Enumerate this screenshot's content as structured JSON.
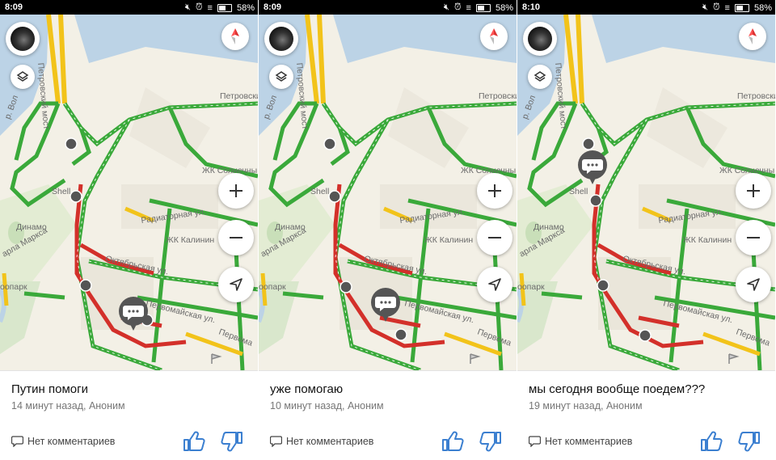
{
  "screens": [
    {
      "status_time": "8:09",
      "battery": "58%",
      "map_labels": {
        "bridge": "Петровский мост",
        "river": "р. Вол",
        "petrovsky": "Петровски",
        "solnechny": "ЖК Солнечны",
        "radiator": "Радиаторная ул.",
        "kalinin": "ЖК Калинин",
        "dinamo": "Динамо",
        "marx": "арла Маркса",
        "oktyabr": "Октябрьская ул.",
        "pervomay": "Первомайская ул.",
        "pervoma2": "Первома",
        "zoopark": "оопарк",
        "shell": "Shell"
      },
      "post": {
        "title": "Путин помоги",
        "meta": "14 минут назад, Аноним",
        "comments": "Нет комментариев"
      }
    },
    {
      "status_time": "8:09",
      "battery": "58%",
      "map_labels": {
        "bridge": "Петровский мост",
        "river": "р. Вол",
        "petrovsky": "Петровски",
        "solnechny": "ЖК Солнечны",
        "radiator": "Радиаторная ул.",
        "kalinin": "ЖК Калинин",
        "dinamo": "Динамо",
        "marx": "арла Маркса",
        "oktyabr": "Октябрьская ул.",
        "pervomay": "Первомайская ул.",
        "pervoma2": "Первома",
        "zoopark": "оопарк",
        "shell": "Shell"
      },
      "post": {
        "title": "уже помогаю",
        "meta": "10 минут назад, Аноним",
        "comments": "Нет комментариев"
      }
    },
    {
      "status_time": "8:10",
      "battery": "58%",
      "map_labels": {
        "bridge": "Петровский мост",
        "river": "р. Вол",
        "petrovsky": "Петровски",
        "solnechny": "ЖК Солнечны",
        "radiator": "Радиаторная ул.",
        "kalinin": "ЖК Калинин",
        "dinamo": "Динамо",
        "marx": "арла Маркса",
        "oktyabr": "Октябрьская ул.",
        "pervomay": "Первомайская ул.",
        "pervoma2": "Первома",
        "zoopark": "оопарк",
        "shell": "Shell"
      },
      "post": {
        "title": "мы сегодня вообще поедем???",
        "meta": "19 минут назад, Аноним",
        "comments": "Нет комментариев"
      }
    }
  ],
  "icons": {
    "avatar": "user-avatar-icon",
    "layers": "layers-icon",
    "compass": "compass-icon",
    "zoom_in": "plus-icon",
    "zoom_out": "minus-icon",
    "locate": "navigation-arrow-icon",
    "comment": "speech-bubble-icon",
    "like": "thumbs-up-icon",
    "dislike": "thumbs-down-icon"
  },
  "colors": {
    "traffic_free": "#3aa93a",
    "traffic_slow": "#f2c31a",
    "traffic_jam": "#d3302a",
    "water": "#bcd3e6",
    "like_blue": "#3b7fd0"
  }
}
